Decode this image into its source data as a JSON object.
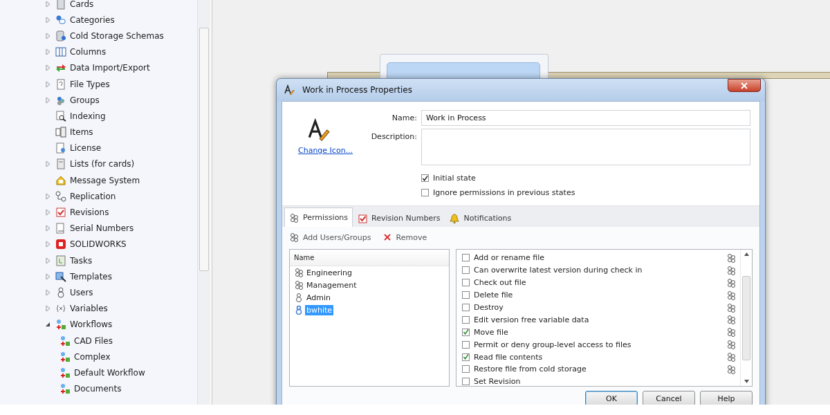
{
  "sidebar": {
    "items": [
      {
        "label": "Cards",
        "expander": true,
        "expanded": false
      },
      {
        "label": "Categories",
        "expander": true,
        "expanded": false
      },
      {
        "label": "Cold Storage Schemas",
        "expander": true,
        "expanded": false
      },
      {
        "label": "Columns",
        "expander": true,
        "expanded": false
      },
      {
        "label": "Data Import/Export",
        "expander": true,
        "expanded": false
      },
      {
        "label": "File Types",
        "expander": true,
        "expanded": false
      },
      {
        "label": "Groups",
        "expander": true,
        "expanded": false
      },
      {
        "label": "Indexing",
        "expander": false
      },
      {
        "label": "Items",
        "expander": false
      },
      {
        "label": "License",
        "expander": false
      },
      {
        "label": "Lists (for cards)",
        "expander": true,
        "expanded": false
      },
      {
        "label": "Message System",
        "expander": false
      },
      {
        "label": "Replication",
        "expander": true,
        "expanded": false
      },
      {
        "label": "Revisions",
        "expander": true,
        "expanded": false
      },
      {
        "label": "Serial Numbers",
        "expander": true,
        "expanded": false
      },
      {
        "label": "SOLIDWORKS",
        "expander": true,
        "expanded": false
      },
      {
        "label": "Tasks",
        "expander": true,
        "expanded": false
      },
      {
        "label": "Templates",
        "expander": true,
        "expanded": false
      },
      {
        "label": "Users",
        "expander": true,
        "expanded": false
      },
      {
        "label": "Variables",
        "expander": true,
        "expanded": false
      },
      {
        "label": "Workflows",
        "expander": true,
        "expanded": true,
        "children": [
          {
            "label": "CAD Files"
          },
          {
            "label": "Complex"
          },
          {
            "label": "Default Workflow"
          },
          {
            "label": "Documents"
          }
        ]
      }
    ]
  },
  "dialog": {
    "title": "Work in Process Properties",
    "change_icon_link": "Change Icon...",
    "name_label": "Name:",
    "name_value": "Work in Process",
    "description_label": "Description:",
    "options": [
      {
        "label": "Initial state",
        "checked": true
      },
      {
        "label": "Ignore permissions in previous states",
        "checked": false
      }
    ],
    "tabs": [
      {
        "label": "Permissions",
        "selected": true
      },
      {
        "label": "Revision Numbers",
        "selected": false
      },
      {
        "label": "Notifications",
        "selected": false
      }
    ],
    "toolbar": [
      {
        "label": "Add Users/Groups",
        "kind": "add"
      },
      {
        "label": "Remove",
        "kind": "remove"
      }
    ],
    "users_list": {
      "column": "Name",
      "items": [
        {
          "label": "Engineering",
          "kind": "group",
          "selected": false
        },
        {
          "label": "Management",
          "kind": "group",
          "selected": false
        },
        {
          "label": "Admin",
          "kind": "user",
          "selected": false
        },
        {
          "label": "bwhite",
          "kind": "user",
          "selected": true
        }
      ]
    },
    "permissions": [
      {
        "label": "Add or rename file",
        "checked": false
      },
      {
        "label": "Can overwrite latest version during check in",
        "checked": false
      },
      {
        "label": "Check out file",
        "checked": false
      },
      {
        "label": "Delete file",
        "checked": false
      },
      {
        "label": "Destroy",
        "checked": false
      },
      {
        "label": "Edit version free variable data",
        "checked": false
      },
      {
        "label": "Move file",
        "checked": true
      },
      {
        "label": "Permit or deny group-level access to files",
        "checked": false
      },
      {
        "label": "Read file contents",
        "checked": true
      },
      {
        "label": "Restore file from cold storage",
        "checked": false
      },
      {
        "label": "Set Revision",
        "checked": false
      }
    ],
    "buttons": [
      {
        "label": "OK",
        "kind": "default"
      },
      {
        "label": "Cancel",
        "kind": "normal"
      },
      {
        "label": "Help",
        "kind": "normal"
      }
    ]
  }
}
